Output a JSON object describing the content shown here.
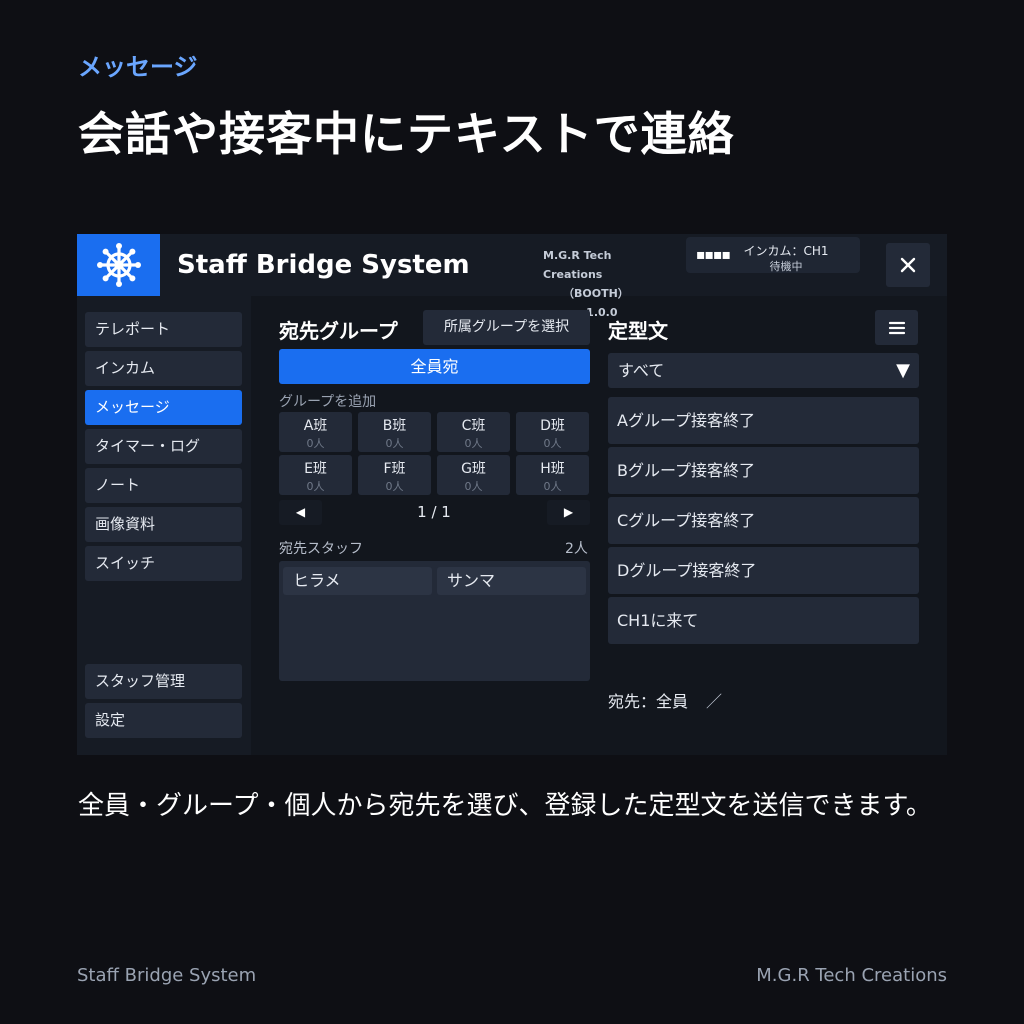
{
  "heading": {
    "kicker": "メッセージ",
    "title": "会話や接客中にテキストで連絡"
  },
  "app": {
    "title": "Staff Bridge System",
    "vendor": "M.G.R Tech Creations",
    "booth": "（BOOTH）",
    "version": "v1.0.0",
    "intercom": {
      "signal": "▪▪▪▪",
      "channel": "インカム：CH1",
      "status": "待機中"
    },
    "close_label": "✕",
    "colors": {
      "accent": "#1a6ef0",
      "panel": "#232a38",
      "background": "#0e0f14"
    }
  },
  "sidebar": {
    "items": [
      {
        "label": "テレポート",
        "active": false
      },
      {
        "label": "インカム",
        "active": false
      },
      {
        "label": "メッセージ",
        "active": true
      },
      {
        "label": "タイマー・ログ",
        "active": false
      },
      {
        "label": "ノート",
        "active": false
      },
      {
        "label": "画像資料",
        "active": false
      },
      {
        "label": "スイッチ",
        "active": false
      }
    ],
    "bottom": [
      {
        "label": "スタッフ管理"
      },
      {
        "label": "設定"
      }
    ]
  },
  "recipients": {
    "title": "宛先グループ",
    "select_group_button": "所属グループを選択",
    "all_button": "全員宛",
    "add_group_label": "グループを追加",
    "groups": [
      {
        "name": "A班",
        "count": "0人"
      },
      {
        "name": "B班",
        "count": "0人"
      },
      {
        "name": "C班",
        "count": "0人"
      },
      {
        "name": "D班",
        "count": "0人"
      },
      {
        "name": "E班",
        "count": "0人"
      },
      {
        "name": "F班",
        "count": "0人"
      },
      {
        "name": "G班",
        "count": "0人"
      },
      {
        "name": "H班",
        "count": "0人"
      }
    ],
    "pager": {
      "prev": "◀",
      "next": "▶",
      "text": "1 / 1"
    },
    "staff_label": "宛先スタッフ",
    "staff_count": "2人",
    "staff": [
      "ヒラメ",
      "サンマ"
    ]
  },
  "templates": {
    "title": "定型文",
    "menu_icon": "≡",
    "filter": {
      "selected": "すべて",
      "arrow": "▼"
    },
    "items": [
      "Aグループ接客終了",
      "Bグループ接客終了",
      "Cグループ接客終了",
      "Dグループ接客終了",
      "CH1に来て"
    ],
    "destination": "宛先：全員",
    "destination_sep": "／"
  },
  "description": "全員・グループ・個人から宛先を選び、登録した定型文を送信できます。",
  "footer": {
    "left": "Staff Bridge System",
    "right": "M.G.R Tech Creations"
  }
}
